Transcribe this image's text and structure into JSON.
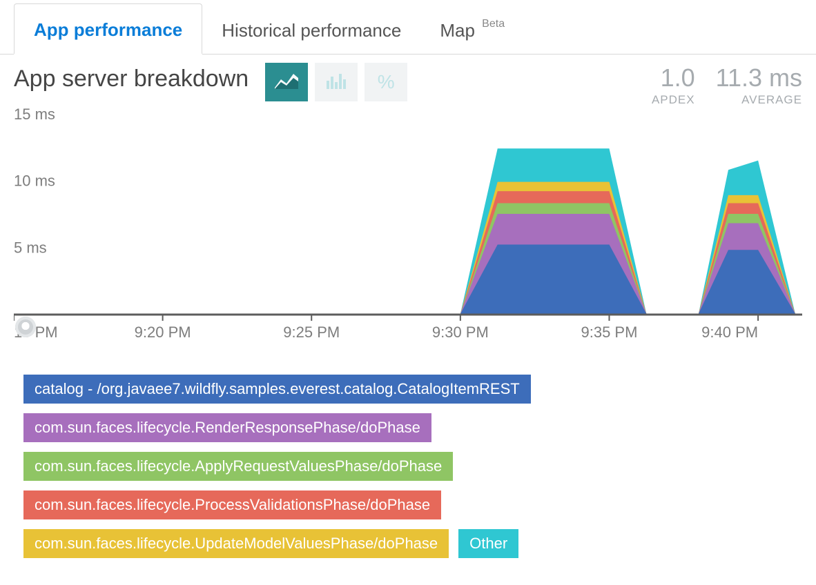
{
  "tabs": {
    "app": "App performance",
    "hist": "Historical performance",
    "map": "Map",
    "map_badge": "Beta"
  },
  "header": {
    "title": "App server breakdown",
    "apdex_val": "1.0",
    "apdex_lbl": "APDEX",
    "avg_val": "11.3 ms",
    "avg_lbl": "AVERAGE",
    "percent_glyph": "%"
  },
  "legend": {
    "i0": "catalog - /org.javaee7.wildfly.samples.everest.catalog.CatalogItemREST",
    "i1": "com.sun.faces.lifecycle.RenderResponsePhase/doPhase",
    "i2": "com.sun.faces.lifecycle.ApplyRequestValuesPhase/doPhase",
    "i3": "com.sun.faces.lifecycle.ProcessValidationsPhase/doPhase",
    "i4": "com.sun.faces.lifecycle.UpdateModelValuesPhase/doPhase",
    "i5": "Other"
  },
  "chart_data": {
    "type": "area",
    "xlabel": "",
    "ylabel": "",
    "ylim": [
      0,
      15
    ],
    "yticks": [
      "15 ms",
      "10 ms",
      "5 ms"
    ],
    "categories": [
      "15 PM",
      "9:20 PM",
      "9:25 PM",
      "9:30 PM",
      "9:35 PM",
      "9:40 PM"
    ],
    "x_index": [
      0,
      1,
      2,
      3,
      3.25,
      4,
      4.25,
      4.6,
      4.8,
      5,
      5.25
    ],
    "series": [
      {
        "name": "catalog - /org.javaee7.wildfly.samples.everest.catalog.CatalogItemREST",
        "color": "#3d6dba",
        "values": [
          0,
          0,
          0,
          0,
          5.2,
          5.2,
          0,
          0,
          4.8,
          4.8,
          0
        ]
      },
      {
        "name": "com.sun.faces.lifecycle.RenderResponsePhase/doPhase",
        "color": "#a76fbd",
        "values": [
          0,
          0,
          0,
          0,
          2.3,
          2.3,
          0,
          0,
          2.0,
          2.0,
          0
        ]
      },
      {
        "name": "com.sun.faces.lifecycle.ApplyRequestValuesPhase/doPhase",
        "color": "#8fc564",
        "values": [
          0,
          0,
          0,
          0,
          0.8,
          0.8,
          0,
          0,
          0.7,
          0.7,
          0
        ]
      },
      {
        "name": "com.sun.faces.lifecycle.ProcessValidationsPhase/doPhase",
        "color": "#e6695a",
        "values": [
          0,
          0,
          0,
          0,
          0.9,
          0.9,
          0,
          0,
          0.8,
          0.8,
          0
        ]
      },
      {
        "name": "com.sun.faces.lifecycle.UpdateModelValuesPhase/doPhase",
        "color": "#e8c236",
        "values": [
          0,
          0,
          0,
          0,
          0.7,
          0.7,
          0,
          0,
          0.6,
          0.6,
          0
        ]
      },
      {
        "name": "Other",
        "color": "#2fc7d2",
        "values": [
          0,
          0,
          0,
          0,
          2.5,
          2.5,
          0,
          0,
          1.9,
          2.6,
          0
        ]
      }
    ]
  }
}
